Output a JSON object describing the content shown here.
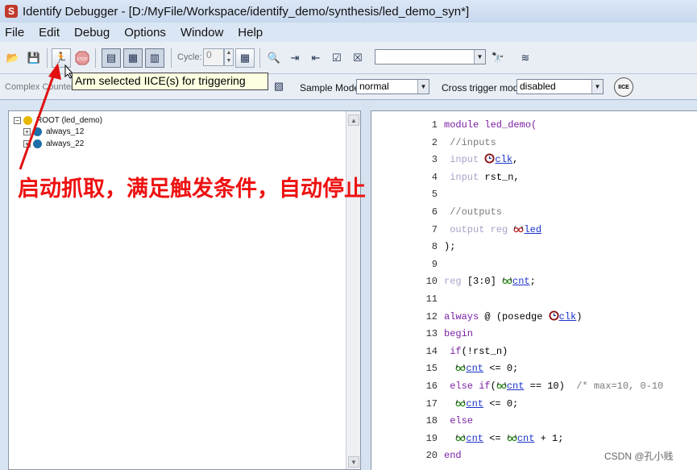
{
  "window": {
    "title": "Identify Debugger - [D:/MyFile/Workspace/identify_demo/synthesis/led_demo_syn*]",
    "logo_letter": "S"
  },
  "menu": [
    "File",
    "Edit",
    "Debug",
    "Options",
    "Window",
    "Help"
  ],
  "toolbar": {
    "cycle_label": "Cycle:",
    "cycle_value": "0",
    "find_value": "",
    "tooltip": "Arm selected IICE(s) for triggering"
  },
  "toolbar2": {
    "complex_counter_label": "Complex Counter",
    "sample_mode_label": "Sample Mode:",
    "sample_mode_value": "normal",
    "cross_trigger_label": "Cross trigger mode:",
    "cross_trigger_value": "disabled",
    "iice_label": "IICE"
  },
  "tree": {
    "root": "ROOT (led_demo)",
    "children": [
      "always_12",
      "always_22"
    ]
  },
  "code": [
    {
      "num": "1",
      "parts": [
        {
          "t": "module led_demo(",
          "c": "kw"
        }
      ]
    },
    {
      "num": "2",
      "parts": [
        {
          "t": " //inputs",
          "c": "cm"
        }
      ]
    },
    {
      "num": "3",
      "parts": [
        {
          "t": " input ",
          "c": "kw-dim"
        },
        {
          "probe": "clock"
        },
        {
          "t": "clk",
          "c": "sig"
        },
        {
          "t": ",",
          "c": ""
        }
      ]
    },
    {
      "num": "4",
      "parts": [
        {
          "t": " input ",
          "c": "kw-dim"
        },
        {
          "t": "rst_n,",
          "c": ""
        }
      ]
    },
    {
      "num": "5",
      "parts": []
    },
    {
      "num": "6",
      "parts": [
        {
          "t": " //outputs",
          "c": "cm"
        }
      ]
    },
    {
      "num": "7",
      "parts": [
        {
          "t": " output reg ",
          "c": "kw-dim"
        },
        {
          "probe": "glasses-red"
        },
        {
          "t": "led",
          "c": "sig"
        }
      ]
    },
    {
      "num": "8",
      "parts": [
        {
          "t": ");",
          "c": ""
        }
      ]
    },
    {
      "num": "9",
      "parts": []
    },
    {
      "num": "10",
      "parts": [
        {
          "t": "reg ",
          "c": "kw-dim"
        },
        {
          "t": "[3:0] ",
          "c": ""
        },
        {
          "probe": "glasses"
        },
        {
          "t": "cnt",
          "c": "sig"
        },
        {
          "t": ";",
          "c": ""
        }
      ]
    },
    {
      "num": "11",
      "parts": []
    },
    {
      "num": "12",
      "parts": [
        {
          "t": "always",
          "c": "kw"
        },
        {
          "t": " @ (posedge ",
          "c": ""
        },
        {
          "probe": "clock"
        },
        {
          "t": "clk",
          "c": "sig"
        },
        {
          "t": ")",
          "c": ""
        }
      ]
    },
    {
      "num": "13",
      "parts": [
        {
          "t": "begin",
          "c": "kw"
        }
      ]
    },
    {
      "num": "14",
      "parts": [
        {
          "t": " if",
          "c": "kw"
        },
        {
          "t": "(!rst_n)",
          "c": ""
        }
      ]
    },
    {
      "num": "15",
      "parts": [
        {
          "t": "  ",
          "c": ""
        },
        {
          "probe": "glasses"
        },
        {
          "t": "cnt",
          "c": "sig"
        },
        {
          "t": " <= 0;",
          "c": ""
        }
      ]
    },
    {
      "num": "16",
      "parts": [
        {
          "t": " else if",
          "c": "kw"
        },
        {
          "t": "(",
          "c": ""
        },
        {
          "probe": "glasses"
        },
        {
          "t": "cnt",
          "c": "sig"
        },
        {
          "t": " == 10)  ",
          "c": ""
        },
        {
          "t": "/* max=10, 0-10",
          "c": "cm"
        }
      ]
    },
    {
      "num": "17",
      "parts": [
        {
          "t": "  ",
          "c": ""
        },
        {
          "probe": "glasses"
        },
        {
          "t": "cnt",
          "c": "sig"
        },
        {
          "t": " <= 0;",
          "c": ""
        }
      ]
    },
    {
      "num": "18",
      "parts": [
        {
          "t": " else",
          "c": "kw"
        }
      ]
    },
    {
      "num": "19",
      "parts": [
        {
          "t": "  ",
          "c": ""
        },
        {
          "probe": "glasses"
        },
        {
          "t": "cnt",
          "c": "sig"
        },
        {
          "t": " <= ",
          "c": ""
        },
        {
          "probe": "glasses"
        },
        {
          "t": "cnt",
          "c": "sig"
        },
        {
          "t": " + 1;",
          "c": ""
        }
      ]
    },
    {
      "num": "20",
      "parts": [
        {
          "t": "end",
          "c": "kw"
        }
      ]
    }
  ],
  "annotation": "启动抓取，满足触发条件，自动停止",
  "watermark": "CSDN @孔小贱",
  "colors": {
    "annotation": "#ee1111",
    "arrow": "#e01010",
    "background": "#d8e4f2"
  }
}
